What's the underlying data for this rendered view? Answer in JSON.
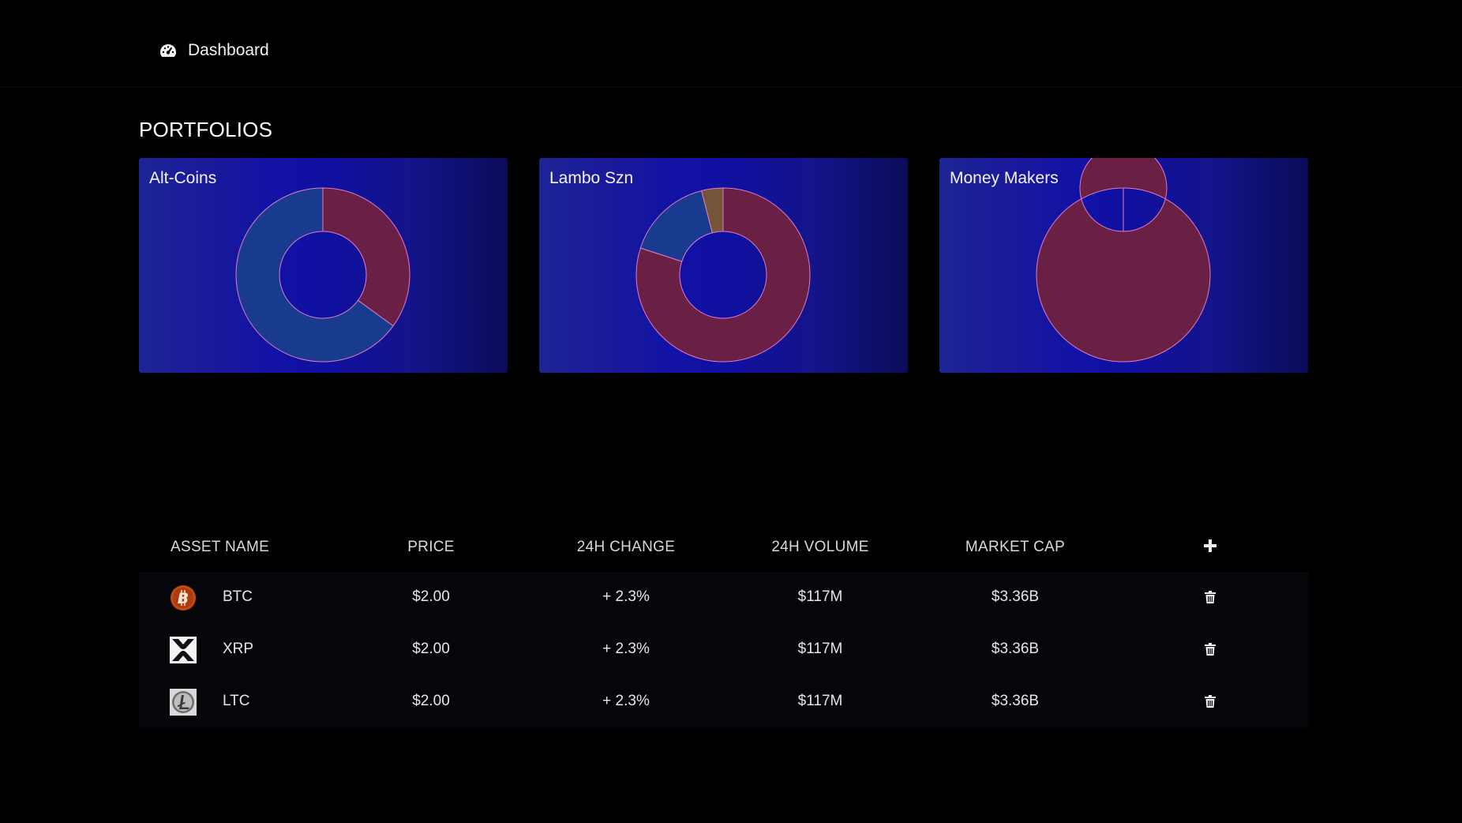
{
  "nav": {
    "dashboard_label": "Dashboard",
    "dashboard_icon": "speedometer-icon"
  },
  "portfolios": {
    "title": "PORTFOLIOS",
    "cards": [
      {
        "name": "Alt-Coins",
        "slices": [
          {
            "value": 35,
            "color": "#6a1f44"
          },
          {
            "value": 65,
            "color": "#183b8f"
          }
        ]
      },
      {
        "name": "Lambo Szn",
        "slices": [
          {
            "value": 80,
            "color": "#6a1f44"
          },
          {
            "value": 16,
            "color": "#183b8f"
          },
          {
            "value": 4,
            "color": "#74553a"
          }
        ]
      },
      {
        "name": "Money Makers",
        "slices": [
          {
            "value": 100,
            "color": "#6a1f44"
          }
        ]
      }
    ]
  },
  "table": {
    "headers": {
      "asset_name": "ASSET NAME",
      "price": "PRICE",
      "change": "24H CHANGE",
      "volume": "24H VOLUME",
      "market_cap": "MARKET CAP"
    },
    "add_icon": "plus-icon",
    "delete_icon": "trash-icon",
    "rows": [
      {
        "symbol": "BTC",
        "icon": "bitcoin-icon",
        "price": "$2.00",
        "change": "+ 2.3%",
        "volume": "$117M",
        "market_cap": "$3.36B"
      },
      {
        "symbol": "XRP",
        "icon": "xrp-icon",
        "price": "$2.00",
        "change": "+ 2.3%",
        "volume": "$117M",
        "market_cap": "$3.36B"
      },
      {
        "symbol": "LTC",
        "icon": "litecoin-icon",
        "price": "$2.00",
        "change": "+ 2.3%",
        "volume": "$117M",
        "market_cap": "$3.36B"
      }
    ]
  },
  "colors": {
    "background": "#000000",
    "card_gradient_start": "#1c2595",
    "card_gradient_end": "#0b0b58",
    "slice_stroke": "#e07ac8"
  }
}
